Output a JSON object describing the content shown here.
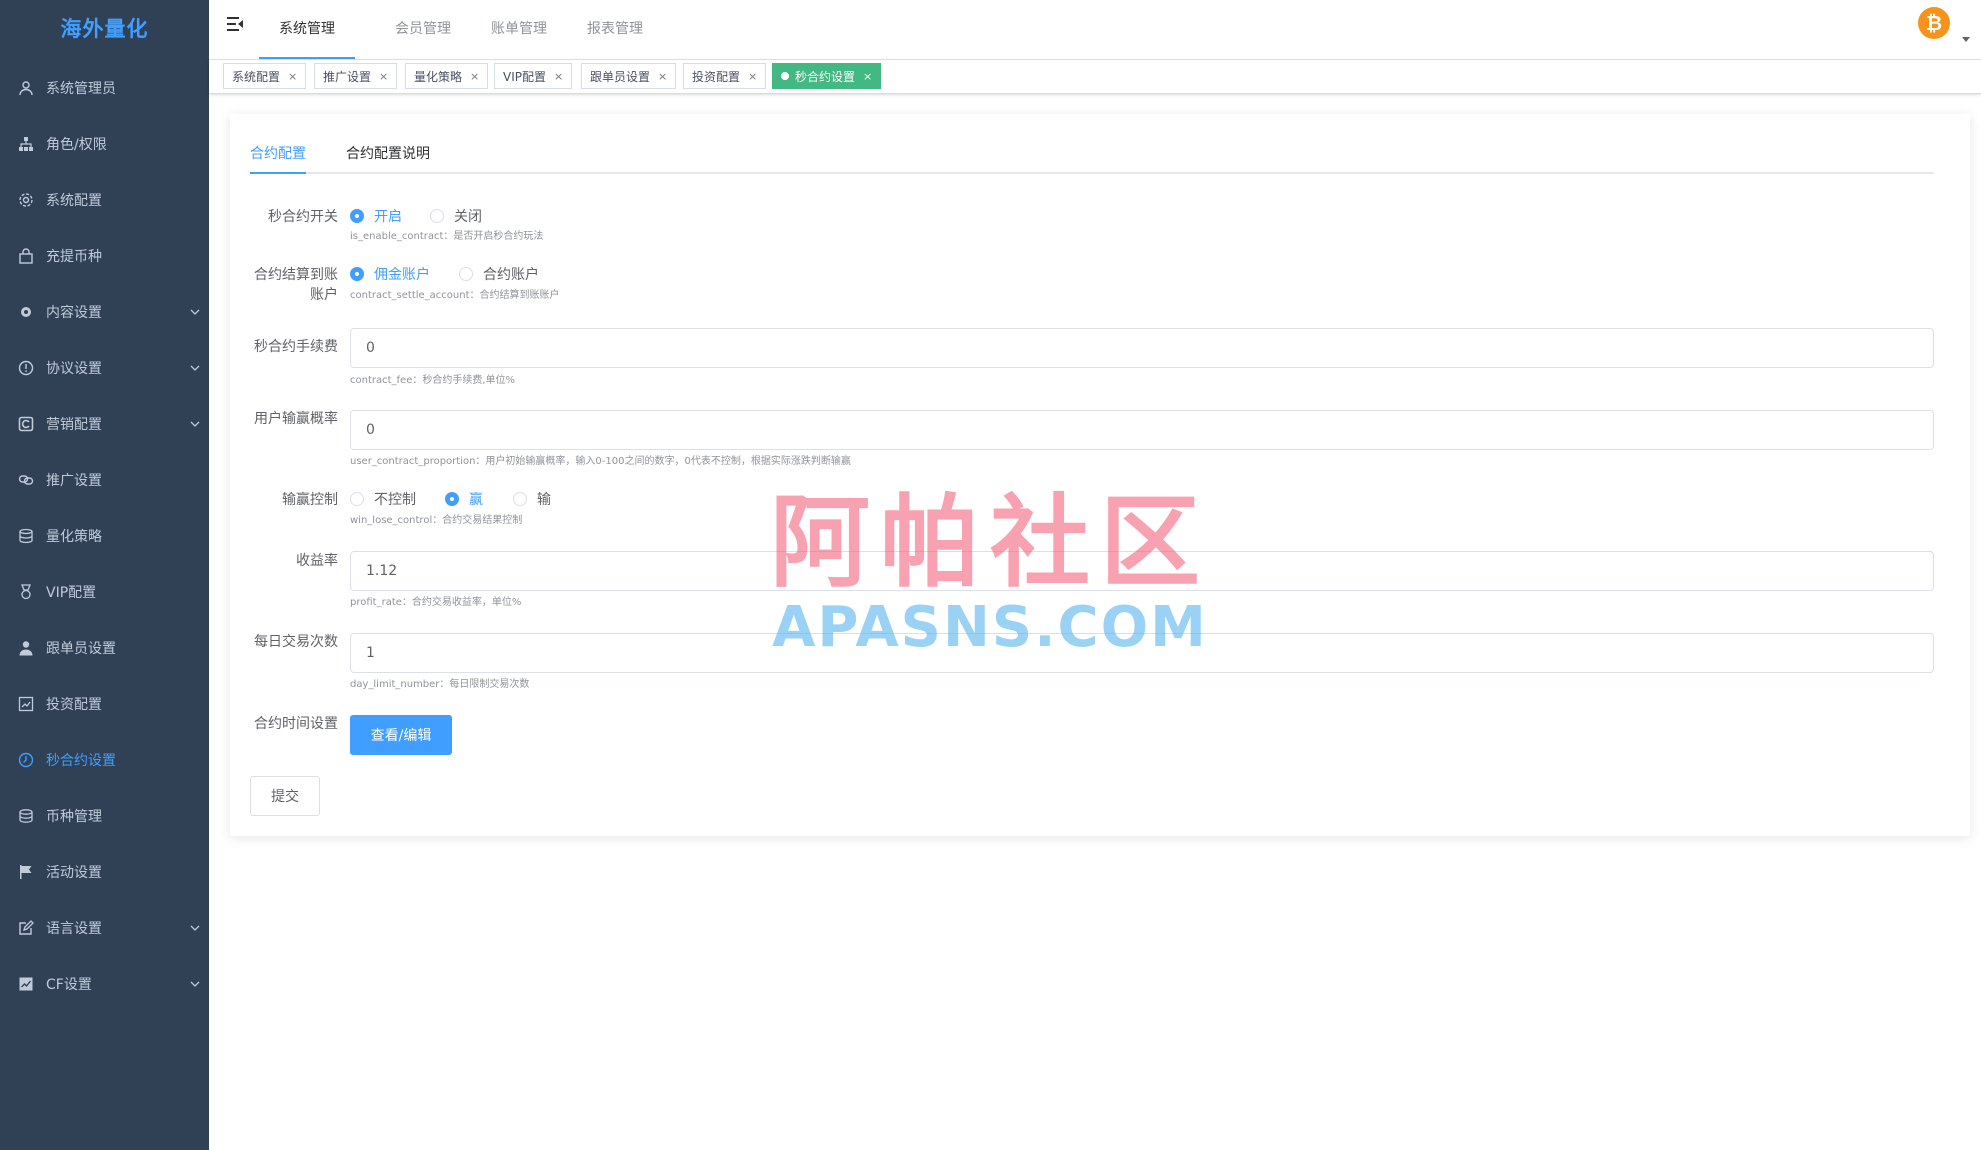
{
  "app": {
    "title": "海外量化"
  },
  "sidebar": {
    "items": [
      {
        "label": "系统管理员",
        "icon": "user-icon",
        "active": false,
        "has_arrow": false
      },
      {
        "label": "角色/权限",
        "icon": "tree-icon",
        "active": false,
        "has_arrow": false
      },
      {
        "label": "系统配置",
        "icon": "gear-icon",
        "active": false,
        "has_arrow": false
      },
      {
        "label": "充提币种",
        "icon": "bag-icon",
        "active": false,
        "has_arrow": false
      },
      {
        "label": "内容设置",
        "icon": "cog-icon",
        "active": false,
        "has_arrow": true
      },
      {
        "label": "协议设置",
        "icon": "info-circle-icon",
        "active": false,
        "has_arrow": true
      },
      {
        "label": "营销配置",
        "icon": "marketing-icon",
        "active": false,
        "has_arrow": true
      },
      {
        "label": "推广设置",
        "icon": "link-icon",
        "active": false,
        "has_arrow": false
      },
      {
        "label": "量化策略",
        "icon": "database-icon",
        "active": false,
        "has_arrow": false
      },
      {
        "label": "VIP配置",
        "icon": "medal-icon",
        "active": false,
        "has_arrow": false
      },
      {
        "label": "跟单员设置",
        "icon": "person-icon",
        "active": false,
        "has_arrow": false
      },
      {
        "label": "投资配置",
        "icon": "chart-board-icon",
        "active": false,
        "has_arrow": false
      },
      {
        "label": "秒合约设置",
        "icon": "clock-icon",
        "active": true,
        "has_arrow": false
      },
      {
        "label": "币种管理",
        "icon": "coins-icon",
        "active": false,
        "has_arrow": false
      },
      {
        "label": "活动设置",
        "icon": "flag-icon",
        "active": false,
        "has_arrow": false
      },
      {
        "label": "语言设置",
        "icon": "edit-icon",
        "active": false,
        "has_arrow": true
      },
      {
        "label": "CF设置",
        "icon": "trend-icon",
        "active": false,
        "has_arrow": true
      }
    ]
  },
  "navbar": {
    "tabs": [
      {
        "label": "系统管理",
        "active": true
      },
      {
        "label": "会员管理",
        "active": false
      },
      {
        "label": "账单管理",
        "active": false
      },
      {
        "label": "报表管理",
        "active": false
      }
    ],
    "avatar_icon": "bitcoin-icon",
    "brand_color": "#409eff",
    "avatar_color": "#f7931a"
  },
  "tags": [
    {
      "label": "系统配置",
      "active": false
    },
    {
      "label": "推广设置",
      "active": false
    },
    {
      "label": "量化策略",
      "active": false
    },
    {
      "label": "VIP配置",
      "active": false
    },
    {
      "label": "跟单员设置",
      "active": false
    },
    {
      "label": "投资配置",
      "active": false
    },
    {
      "label": "秒合约设置",
      "active": true
    }
  ],
  "tag_close": "×",
  "form": {
    "tabs": [
      {
        "label": "合约配置",
        "active": true
      },
      {
        "label": "合约配置说明",
        "active": false
      }
    ],
    "enable": {
      "label": "秒合约开关",
      "options": [
        "开启",
        "关闭"
      ],
      "selected": 0,
      "hint": "is_enable_contract：是否开启秒合约玩法"
    },
    "settle": {
      "label_line1": "合约结算到账",
      "label_line2": "账户",
      "options": [
        "佣金账户",
        "合约账户"
      ],
      "selected": 0,
      "hint": "contract_settle_account：合约结算到账账户"
    },
    "fee": {
      "label": "秒合约手续费",
      "value": "0",
      "hint": "contract_fee：秒合约手续费,单位%"
    },
    "proportion": {
      "label": "用户输赢概率",
      "value": "0",
      "hint": "user_contract_proportion：用户初始输赢概率，输入0-100之间的数字，0代表不控制，根据实际涨跌判断输赢"
    },
    "win_lose": {
      "label": "输赢控制",
      "options": [
        "不控制",
        "赢",
        "输"
      ],
      "selected": 1,
      "hint": "win_lose_control：合约交易结果控制"
    },
    "profit": {
      "label": "收益率",
      "value": "1.12",
      "hint": "profit_rate：合约交易收益率，单位%"
    },
    "day_limit": {
      "label": "每日交易次数",
      "value": "1",
      "hint": "day_limit_number：每日限制交易次数"
    },
    "time": {
      "label": "合约时间设置",
      "button": "查看/编辑"
    },
    "submit": "提交"
  },
  "watermark": {
    "line1": "阿帕社区",
    "line2": "APASNS.COM"
  }
}
